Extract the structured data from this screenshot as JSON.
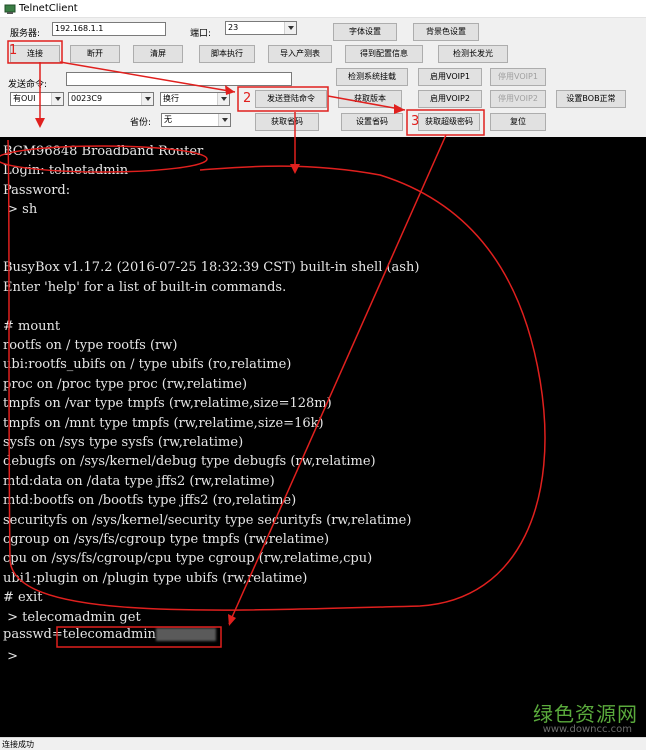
{
  "window": {
    "title": "TelnetClient"
  },
  "connection": {
    "server_label": "服务器:",
    "server_value": "192.168.1.1",
    "port_label": "端口:",
    "port_value": "23",
    "send_cmd_label": "发送命令:",
    "send_cmd_value": "",
    "province_label": "省份:",
    "province_value": "无"
  },
  "selects": {
    "isp": "有OUI",
    "oui": "0023C9",
    "newline": "换行"
  },
  "buttons": {
    "connect": "连接",
    "disconnect": "断开",
    "clear": "清屏",
    "script_run": "脚本执行",
    "import_list": "导入产测表",
    "font_settings": "字体设置",
    "bg_color": "背景色设置",
    "get_config": "得到配置信息",
    "detect_long_light": "检测长发光",
    "check_system_mount": "检测系统挂载",
    "enable_voip1": "启用VOIP1",
    "disable_voip1": "停用VOIP1",
    "send_login_cmd": "发送登陆命令",
    "get_version": "获取版本",
    "enable_voip2": "启用VOIP2",
    "disable_voip2": "停用VOIP2",
    "set_bob_normal": "设置BOB正常",
    "get_province_code": "获取省码",
    "set_province_code": "设置省码",
    "get_super_password": "获取超级密码",
    "reset": "复位"
  },
  "annotations": {
    "one": "1",
    "two": "2",
    "three": "3"
  },
  "terminal": {
    "lines": [
      "BCM96848 Broadband Router",
      "Login: telnetadmin",
      "Password:",
      " > sh",
      "",
      "",
      "BusyBox v1.17.2 (2016-07-25 18:32:39 CST) built-in shell (ash)",
      "Enter 'help' for a list of built-in commands.",
      "",
      "# mount",
      "rootfs on / type rootfs (rw)",
      "ubi:rootfs_ubifs on / type ubifs (ro,relatime)",
      "proc on /proc type proc (rw,relatime)",
      "tmpfs on /var type tmpfs (rw,relatime,size=128m)",
      "tmpfs on /mnt type tmpfs (rw,relatime,size=16k)",
      "sysfs on /sys type sysfs (rw,relatime)",
      "debugfs on /sys/kernel/debug type debugfs (rw,relatime)",
      "mtd:data on /data type jffs2 (rw,relatime)",
      "mtd:bootfs on /bootfs type jffs2 (ro,relatime)",
      "securityfs on /sys/kernel/security type securityfs (rw,relatime)",
      "cgroup on /sys/fs/cgroup type tmpfs (rw,relatime)",
      "cpu on /sys/fs/cgroup/cpu type cgroup (rw,relatime,cpu)",
      "ubi1:plugin on /plugin type ubifs (rw,relatime)",
      "# exit",
      " > telecomadmin get"
    ],
    "passwd_prefix": "passwd=",
    "passwd_value": "telecomadmin",
    "prompt": " >"
  },
  "status": {
    "text": "连接成功"
  },
  "watermark": {
    "main": "绿色资源网",
    "sub": "www.downcc.com"
  },
  "colors": {
    "annotation": "#e0201e",
    "terminal_bg": "#000000",
    "terminal_fg": "#e6e6e6",
    "watermark": "#5aaa3c"
  }
}
